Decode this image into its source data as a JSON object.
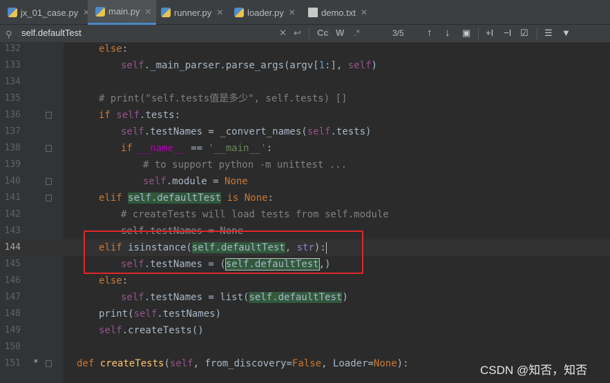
{
  "tabs": [
    {
      "label": "jx_01_case.py",
      "icon": "python-file-icon",
      "active": false
    },
    {
      "label": "main.py",
      "icon": "python-file-icon",
      "active": true
    },
    {
      "label": "runner.py",
      "icon": "python-file-icon",
      "active": false
    },
    {
      "label": "loader.py",
      "icon": "python-file-icon",
      "active": false
    },
    {
      "label": "demo.txt",
      "icon": "text-file-icon",
      "active": false
    }
  ],
  "search": {
    "query": "self.defaultTest",
    "match_count": "3/5",
    "match_case_label": "Cc",
    "words_label": "W",
    "regex_label": ".*"
  },
  "editor": {
    "current_line": "144",
    "lines": [
      {
        "n": "132"
      },
      {
        "n": "133"
      },
      {
        "n": "134"
      },
      {
        "n": "135"
      },
      {
        "n": "136"
      },
      {
        "n": "137"
      },
      {
        "n": "138"
      },
      {
        "n": "139"
      },
      {
        "n": "140"
      },
      {
        "n": "141"
      },
      {
        "n": "142"
      },
      {
        "n": "143"
      },
      {
        "n": "144"
      },
      {
        "n": "145"
      },
      {
        "n": "146"
      },
      {
        "n": "147"
      },
      {
        "n": "148"
      },
      {
        "n": "149"
      },
      {
        "n": "150"
      },
      {
        "n": "151"
      }
    ],
    "line151_marker": "*",
    "t": {
      "else": "else",
      "colon": ":",
      "self": "self",
      "main_parser": "._main_parser.parse_args(argv[",
      "slice": "1",
      "slice_end": ":], ",
      "close_paren": ")",
      "comment135": "# print(\"self.tests值是多少\", self.tests) []",
      "if": "if",
      "tests_colon": ".tests:",
      "testnames_eq": ".testNames = _convert_names(",
      "dot_tests": ".tests",
      "name_dunder": "__name__",
      "eqeq": " == ",
      "main_str": "'__main__'",
      "comment139": "# to support python -m unittest ...",
      "module_eq": ".module = ",
      "none": "None",
      "elif": "elif",
      "defaultTest": "self.defaultTest",
      "is": " is ",
      "comment142": "# createTests will load tests from self.module",
      "line143": "self.testNames = None",
      "isinstance": " isinstance(",
      "comma_str": ", ",
      "strk": "str",
      "paren_colon": "):",
      "testnames_tuple": ".testNames = (",
      "tuple_end": ",)",
      "testnames_list": ".testNames = ",
      "list": "list(",
      "print": "print(",
      "dot_testnames": ".testNames)",
      "createtests_call": ".createTests()",
      "def": "def",
      "createTests": "createTests",
      "def_args_a": "(",
      "def_args_b": ", from_discovery=",
      "false": "False",
      "def_args_c": ", Loader=",
      "def_args_d": "):"
    }
  },
  "watermark": "CSDN @知否，知否"
}
